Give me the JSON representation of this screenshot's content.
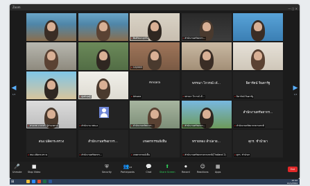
{
  "window": {
    "title": "Zoom",
    "controls": "— □ ✕"
  },
  "nav": {
    "left_page": "1/2",
    "right_page": "1/2"
  },
  "tiles": [
    {
      "type": "video",
      "name": "",
      "scene": "meeting-room-blue"
    },
    {
      "type": "video",
      "name": "",
      "scene": "meeting-room-blue"
    },
    {
      "type": "video",
      "name": "พิมพ์ชนก ศุภกิจ",
      "scene": "woman-mask"
    },
    {
      "type": "video",
      "name": "สำนักงานทรัพยากร...",
      "scene": "dim-room"
    },
    {
      "type": "video",
      "name": "",
      "scene": "man-mask-blue"
    },
    {
      "type": "video",
      "name": "",
      "scene": "office-desk"
    },
    {
      "type": "video",
      "name": "",
      "scene": "man-mask-green"
    },
    {
      "type": "video",
      "name": "12/2003",
      "scene": "brick-room"
    },
    {
      "type": "video",
      "name": "",
      "scene": "woman-purple"
    },
    {
      "type": "video",
      "name": "",
      "scene": "woman-mask-white"
    },
    {
      "type": "video",
      "name": "",
      "scene": "woman-beach"
    },
    {
      "type": "video",
      "name": "ศูนย์ ดุษฎี",
      "scene": "white-room"
    },
    {
      "type": "name",
      "name": "Arisara",
      "center": "Arisara"
    },
    {
      "type": "name",
      "name": "พรรณา โกวรณ์ เจ้...",
      "center": "พรรณา โกวรณ์ เจ้..."
    },
    {
      "type": "name",
      "name": "ธิดารัตน์ จินดารัฐ",
      "center": "ธิดารัตน์ จินดารัฐ"
    },
    {
      "type": "video",
      "name": "ทรงเทพ มาลาศรี ผู้อำนวยการ",
      "scene": "woman-portrait"
    },
    {
      "type": "avatar",
      "name": "สำนักงาน กศน.อ",
      "center": ""
    },
    {
      "type": "video",
      "name": "สำนักงานทรัพยากร...",
      "scene": "woman-drinking"
    },
    {
      "type": "video",
      "name": "สำนักงานทรัพยากร...",
      "scene": "woman-palm"
    },
    {
      "type": "name",
      "name": "สำนักงานทรัพยากรธรรมชาติ",
      "center": "สำนักงานทรัพยากร..."
    },
    {
      "type": "name",
      "name": "สนง.ปลัดกระทรวง",
      "center": "สนง.ปลัดกระทรวง"
    },
    {
      "type": "name",
      "name": "สำนักงานทรัพยากร...",
      "center": "สำนักงานทรัพยากร..."
    },
    {
      "type": "name",
      "name": "เกษตรกรรมยั่งยืน",
      "center": "เกษตรกรรมยั่งยืน"
    },
    {
      "type": "name",
      "name": "สำนักงานทรัพยากรธรรมชาติ(Thailand 2)",
      "center": "ทรายทอง ลำปลาย..."
    },
    {
      "type": "name",
      "name": "ดุกร. ชำนำผา",
      "center": "ดุกร. ชำนำผา"
    }
  ],
  "toolbar": {
    "unmute": "Unmute",
    "stop_video": "Stop Video",
    "security": "Security",
    "participants": "Participants",
    "participants_count": "23",
    "chat": "Chat",
    "share_screen": "Share Screen",
    "record": "Record",
    "reactions": "Reactions",
    "apps": "Apps",
    "end": "End"
  },
  "taskbar": {
    "time": "10:42",
    "date": "14/1/2564"
  },
  "colors": {
    "share": "#2fd35a",
    "end": "#e02828",
    "arrow": "#5ab0ff",
    "mic_off": "#e33333"
  }
}
